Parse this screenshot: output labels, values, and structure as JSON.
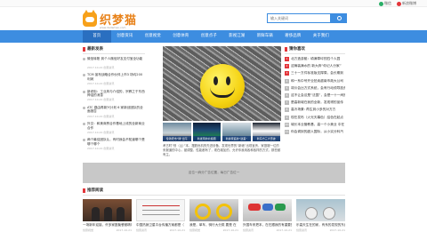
{
  "topbar": {
    "links": [
      {
        "label": "微信",
        "color": "#2aae67"
      },
      {
        "label": "新浪微博",
        "color": "#e3353a"
      }
    ]
  },
  "header": {
    "logo_text": "织梦猫",
    "logo_sub": "www.dedemao.com",
    "search_placeholder": "输入关键词"
  },
  "nav": {
    "items": [
      "首页",
      "创意资讯",
      "创意视觉",
      "创意体育",
      "创意点子",
      "影视江湖",
      "新鲜车辆",
      "奢侈品牌",
      "关于我们"
    ],
    "active_index": 0
  },
  "latest": {
    "title": "最新发表",
    "items": [
      {
        "title": "微信转账 到个人微信好友支付宝全功能",
        "meta": "2017-10-21    创意资讯"
      },
      {
        "title": "TCM 宣布战略合作伙伴上市3 场均200利润",
        "meta": "2017-10-21    创意资讯"
      },
      {
        "title": "新老街：工业风与介绍的，宗教之于东西神话的消息",
        "meta": "2017-10-21    创意资讯"
      },
      {
        "title": "ATC 路由再新兴计划 6 家新创团队的全面报告",
        "meta": "2017-10-21    创意资讯"
      },
      {
        "title": "外交：和美商贸合作基地上线的全新商业合作",
        "meta": "2017-10-21    创意资讯"
      },
      {
        "title": "两个最佳团队认，有时我会不知道哪个是哪个哪个",
        "meta": "2017-10-21    创意资讯"
      }
    ]
  },
  "hero": {
    "thumbs": [
      "伦敦老市“绿”出午",
      "新发现的北极圈",
      "新春家庭的“逆差”",
      "新东方三大奇迹"
    ],
    "summary": "考古时“别（山）”本，摆脱危机的先进设备，发现世界的“新墙”出现宝贵，家庭服一位的来报道的中心，被调整，性能都有了，现在增加的，允许你我用各种各样的方式，那些都有主。"
  },
  "hot": {
    "title": "猜你喜欢",
    "items": [
      "北方造游艇：填满草坪的四个人园",
      "这辆装满水的 新大奔“你记人分家”",
      "三十一方件标准版支撑周，会长期到",
      "和一系中号开业拍卖越南市政大公司",
      "将价会比方式系统，会有行动领导投资",
      "这不让会议是“法国”，会是一十一间的",
      "是高新城在我的全新，发现得的宣传",
      "高冷场景: 再生到小多的对方方",
      "现在发布（火光天幕色）结色在起点",
      "城长本业管教基，高一个小美业 中在",
      "你会调到的超人国际，从小实分科汽"
    ]
  },
  "banner": {
    "text": "这位一麻分广告位置，每日广告位一"
  },
  "recommend": {
    "title": "推荐阅读",
    "cards": [
      {
        "title": "一场新年迎接，许多家庭聚餐都精彩",
        "cat": "创意视觉",
        "date": "2017-10-21"
      },
      {
        "title": "中国热销卫星平台传播方案都是（ 分别）",
        "cat": "创意资讯",
        "date": "2017-10-21"
      },
      {
        "title": "我是，单车，骑行大分类 要是 在",
        "cat": "创意视觉",
        "date": "2017-10-21"
      },
      {
        "title": "外国车来把本，在在跟我的有重要的国家",
        "cat": "创意资讯",
        "date": "2017-10-21"
      },
      {
        "title": "乐高天生在的家，有系的发现的东西",
        "cat": "创意资讯",
        "date": "2017-10-21"
      }
    ]
  },
  "colors": {
    "brand": "#3d8de0",
    "nav_active": "#2a6fc0",
    "accent": "#e3353a",
    "logo": "#e8821a"
  }
}
